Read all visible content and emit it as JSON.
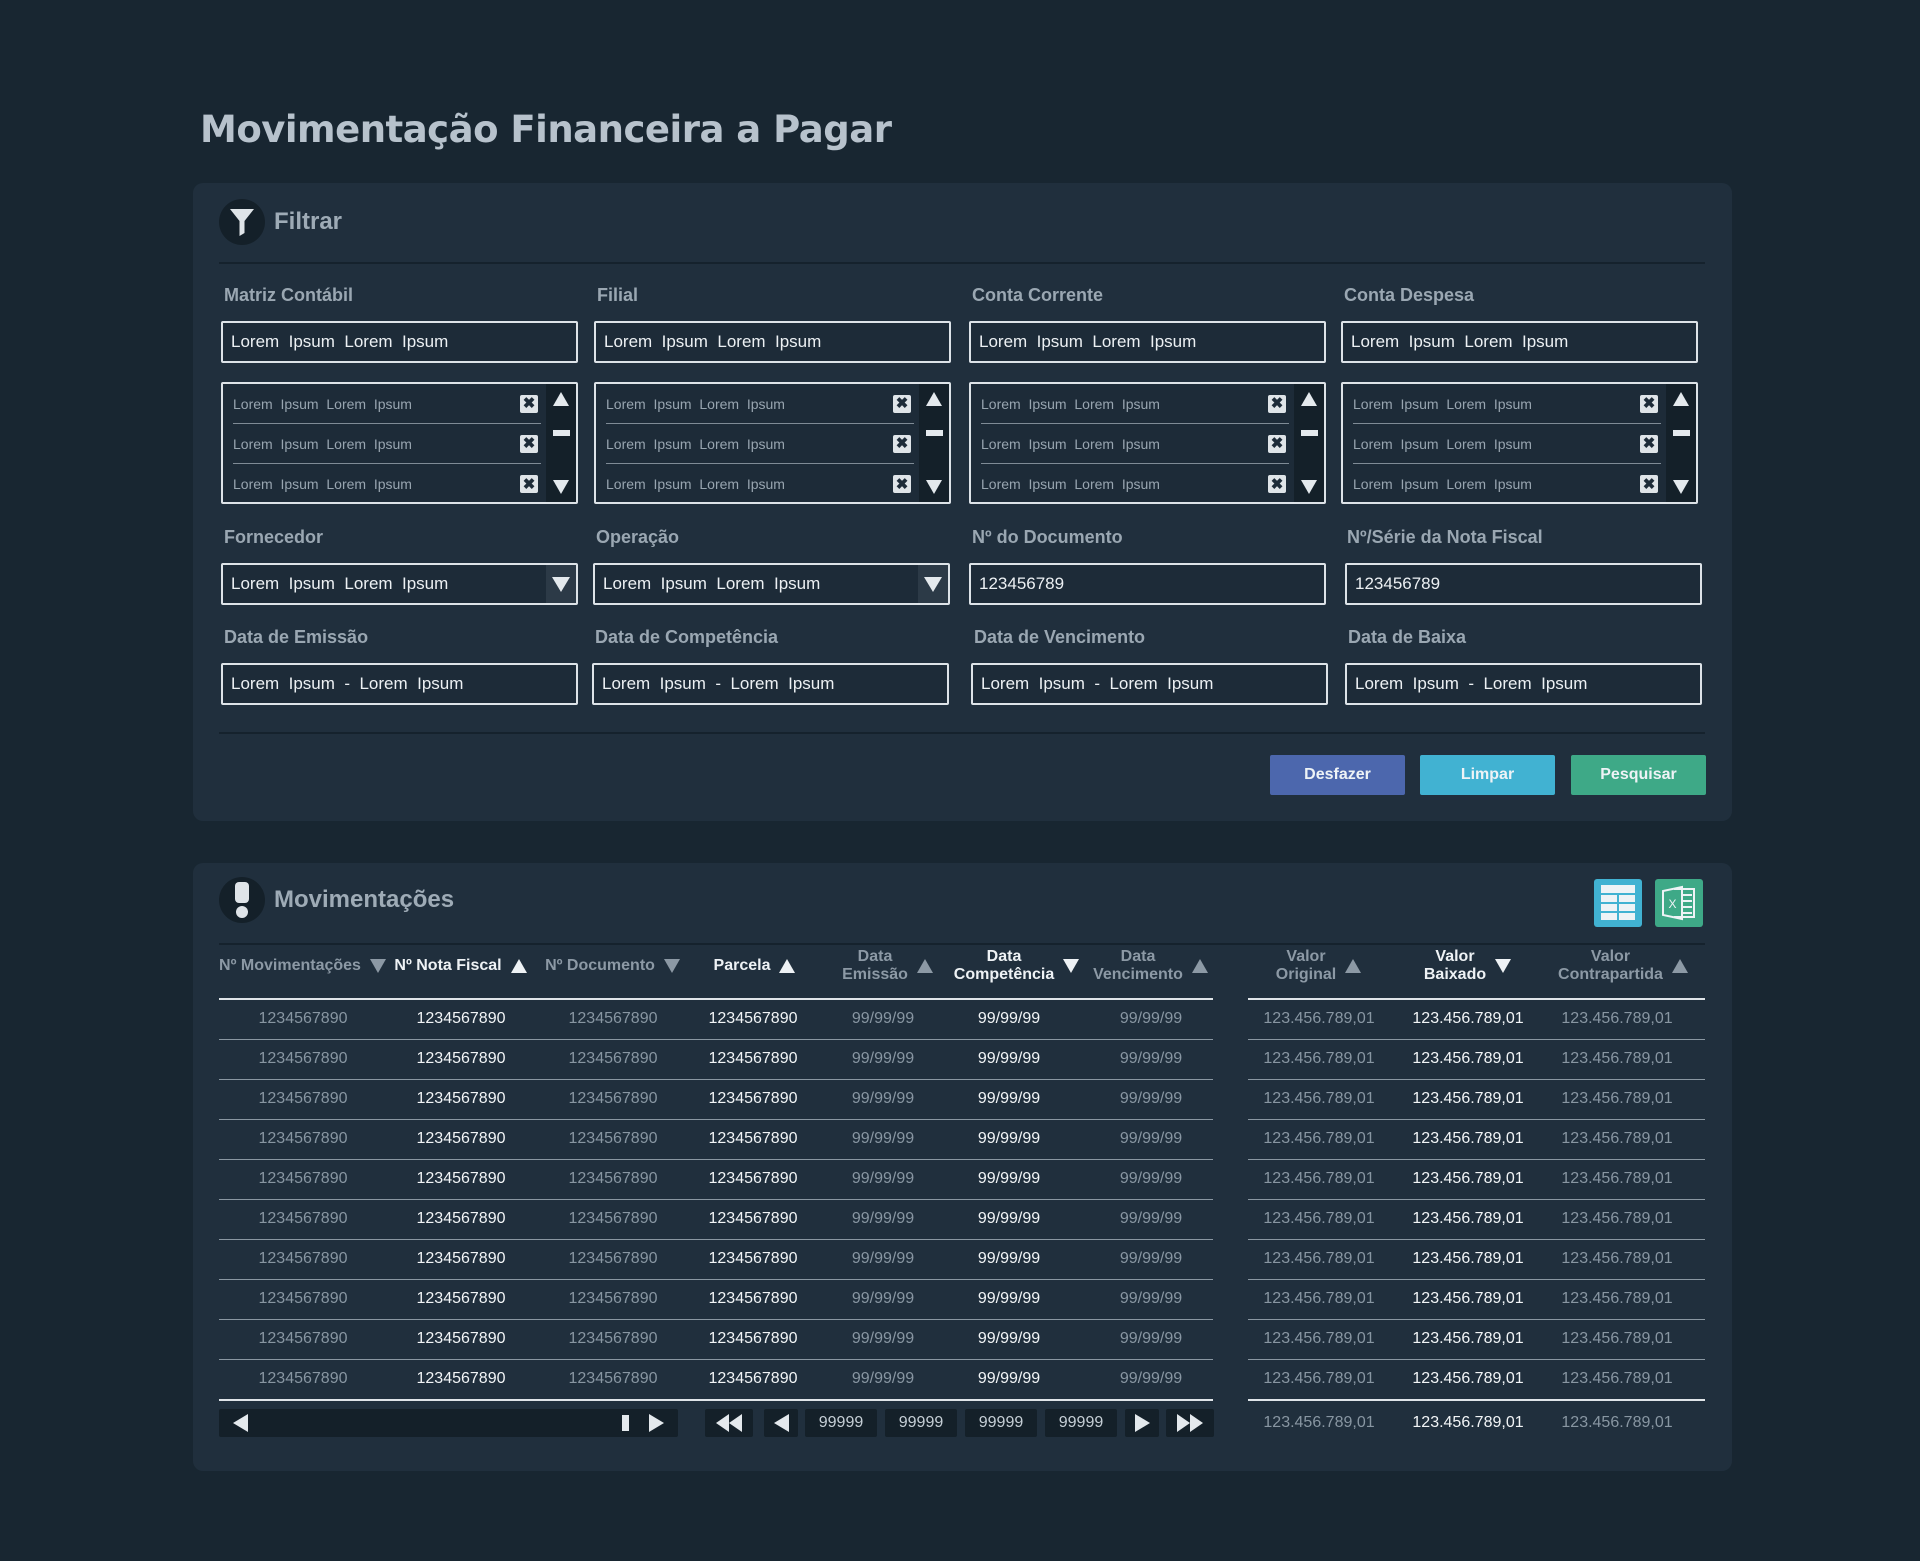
{
  "page": {
    "title": "Movimentação Financeira a Pagar"
  },
  "filter": {
    "title": "Filtrar",
    "fields": {
      "matriz": {
        "label": "Matriz Contábil",
        "value": "Lorem  Ipsum  Lorem  Ipsum",
        "list": [
          "Lorem  Ipsum  Lorem  Ipsum",
          "Lorem  Ipsum  Lorem  Ipsum",
          "Lorem  Ipsum  Lorem  Ipsum"
        ]
      },
      "filial": {
        "label": "Filial",
        "value": "Lorem  Ipsum  Lorem  Ipsum",
        "list": [
          "Lorem  Ipsum  Lorem  Ipsum",
          "Lorem  Ipsum  Lorem  Ipsum",
          "Lorem  Ipsum  Lorem  Ipsum"
        ]
      },
      "conta_corrente": {
        "label": "Conta Corrente",
        "value": "Lorem  Ipsum  Lorem  Ipsum",
        "list": [
          "Lorem  Ipsum  Lorem  Ipsum",
          "Lorem  Ipsum  Lorem  Ipsum",
          "Lorem  Ipsum  Lorem  Ipsum"
        ]
      },
      "conta_despesa": {
        "label": "Conta Despesa",
        "value": "Lorem  Ipsum  Lorem  Ipsum",
        "list": [
          "Lorem  Ipsum  Lorem  Ipsum",
          "Lorem  Ipsum  Lorem  Ipsum",
          "Lorem  Ipsum  Lorem  Ipsum"
        ]
      },
      "fornecedor": {
        "label": "Fornecedor",
        "value": "Lorem  Ipsum  Lorem  Ipsum"
      },
      "operacao": {
        "label": "Operação",
        "value": "Lorem  Ipsum  Lorem  Ipsum"
      },
      "num_documento": {
        "label": "Nº do Documento",
        "value": "123456789"
      },
      "num_serie_nf": {
        "label": "Nº/Série da Nota Fiscal",
        "value": "123456789"
      },
      "data_emissao": {
        "label": "Data de Emissão",
        "value": "Lorem  Ipsum  -  Lorem  Ipsum"
      },
      "data_competencia": {
        "label": "Data de Competência",
        "value": "Lorem  Ipsum  -  Lorem  Ipsum"
      },
      "data_vencimento": {
        "label": "Data de Vencimento",
        "value": "Lorem  Ipsum  -  Lorem  Ipsum"
      },
      "data_baixa": {
        "label": "Data de Baixa",
        "value": "Lorem  Ipsum  -  Lorem  Ipsum"
      }
    },
    "buttons": {
      "undo": "Desfazer",
      "clear": "Limpar",
      "search": "Pesquisar"
    }
  },
  "movements": {
    "title": "Movimentações",
    "columns": [
      {
        "label": "Nº Movimentações",
        "sort": "desc"
      },
      {
        "label": "Nº Nota Fiscal",
        "sort": "asc"
      },
      {
        "label": "Nº Documento",
        "sort": "desc"
      },
      {
        "label": "Parcela",
        "sort": "asc"
      },
      {
        "label": "Data\nEmissão",
        "sort": "asc"
      },
      {
        "label": "Data\nCompetência",
        "sort": "desc"
      },
      {
        "label": "Data\nVencimento",
        "sort": "asc"
      },
      {
        "label": "Valor\nOriginal",
        "sort": "asc"
      },
      {
        "label": "Valor\nBaixado",
        "sort": "desc"
      },
      {
        "label": "Valor\nContrapartida",
        "sort": "asc"
      }
    ],
    "highlighted_columns": [
      1,
      3,
      5,
      8
    ],
    "rows": [
      [
        "1234567890",
        "1234567890",
        "1234567890",
        "1234567890",
        "99/99/99",
        "99/99/99",
        "99/99/99",
        "123.456.789,01",
        "123.456.789,01",
        "123.456.789,01"
      ],
      [
        "1234567890",
        "1234567890",
        "1234567890",
        "1234567890",
        "99/99/99",
        "99/99/99",
        "99/99/99",
        "123.456.789,01",
        "123.456.789,01",
        "123.456.789,01"
      ],
      [
        "1234567890",
        "1234567890",
        "1234567890",
        "1234567890",
        "99/99/99",
        "99/99/99",
        "99/99/99",
        "123.456.789,01",
        "123.456.789,01",
        "123.456.789,01"
      ],
      [
        "1234567890",
        "1234567890",
        "1234567890",
        "1234567890",
        "99/99/99",
        "99/99/99",
        "99/99/99",
        "123.456.789,01",
        "123.456.789,01",
        "123.456.789,01"
      ],
      [
        "1234567890",
        "1234567890",
        "1234567890",
        "1234567890",
        "99/99/99",
        "99/99/99",
        "99/99/99",
        "123.456.789,01",
        "123.456.789,01",
        "123.456.789,01"
      ],
      [
        "1234567890",
        "1234567890",
        "1234567890",
        "1234567890",
        "99/99/99",
        "99/99/99",
        "99/99/99",
        "123.456.789,01",
        "123.456.789,01",
        "123.456.789,01"
      ],
      [
        "1234567890",
        "1234567890",
        "1234567890",
        "1234567890",
        "99/99/99",
        "99/99/99",
        "99/99/99",
        "123.456.789,01",
        "123.456.789,01",
        "123.456.789,01"
      ],
      [
        "1234567890",
        "1234567890",
        "1234567890",
        "1234567890",
        "99/99/99",
        "99/99/99",
        "99/99/99",
        "123.456.789,01",
        "123.456.789,01",
        "123.456.789,01"
      ],
      [
        "1234567890",
        "1234567890",
        "1234567890",
        "1234567890",
        "99/99/99",
        "99/99/99",
        "99/99/99",
        "123.456.789,01",
        "123.456.789,01",
        "123.456.789,01"
      ],
      [
        "1234567890",
        "1234567890",
        "1234567890",
        "1234567890",
        "99/99/99",
        "99/99/99",
        "99/99/99",
        "123.456.789,01",
        "123.456.789,01",
        "123.456.789,01"
      ]
    ],
    "totals": [
      "123.456.789,01",
      "123.456.789,01",
      "123.456.789,01"
    ],
    "pager": {
      "pages": [
        "99999",
        "99999",
        "99999",
        "99999"
      ]
    }
  },
  "colors": {
    "background": "#182631",
    "panel": "#202f3d",
    "undo_button": "#4c67ad",
    "clear_button": "#41b2d2",
    "search_button": "#3ea987",
    "grid_button": "#41b2d2",
    "excel_button": "#3ea987"
  },
  "icons": {
    "filter": "funnel-icon",
    "movements": "exclamation-icon",
    "grid": "grid-view-icon",
    "excel": "excel-export-icon"
  }
}
